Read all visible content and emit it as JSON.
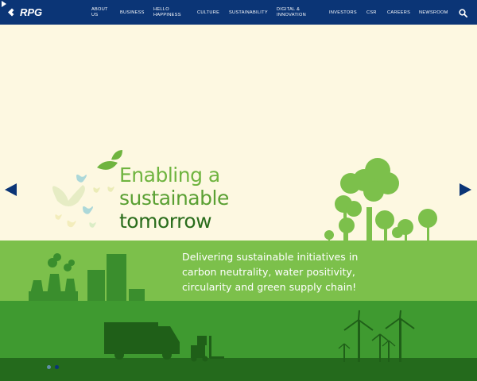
{
  "header": {
    "logo_text": "RPG",
    "nav": [
      {
        "label": "ABOUT US"
      },
      {
        "label": "BUSINESS"
      },
      {
        "label": "HELLO HAPPINESS"
      },
      {
        "label": "CULTURE"
      },
      {
        "label": "SUSTAINABILITY"
      },
      {
        "label": "DIGITAL & INNOVATION"
      },
      {
        "label": "INVESTORS"
      },
      {
        "label": "CSR"
      },
      {
        "label": "CAREERS"
      },
      {
        "label": "NEWSROOM"
      }
    ],
    "icons": {
      "search": "search-icon",
      "play": "play-icon"
    }
  },
  "hero": {
    "headline": {
      "line1": "Enabling a",
      "line2": "sustainable",
      "line3": "tomorrow"
    },
    "subtext": "Delivering sustainable initiatives in carbon neutrality, water positivity, circularity and green supply chain!",
    "slider": {
      "prev_icon": "arrow-left-icon",
      "next_icon": "arrow-right-icon",
      "slide_count": 2,
      "active_slide": 2
    }
  },
  "colors": {
    "nav_bg": "#0b3576",
    "cream_bg": "#fdf8e1",
    "light_green": "#7cc04b",
    "mid_green": "#3f9a30",
    "dark_green": "#246a1c",
    "headline_green": "#6fb43f",
    "headline_dark": "#2a6d1c"
  }
}
